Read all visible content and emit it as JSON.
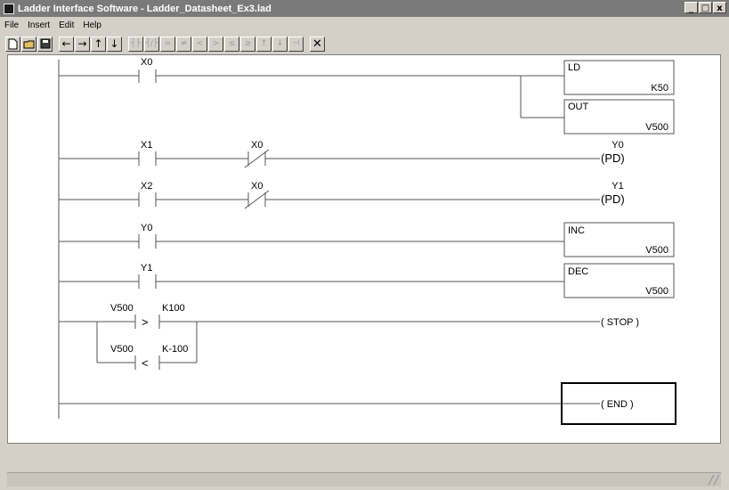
{
  "window": {
    "title": "Ladder Interface Software - Ladder_Datasheet_Ex3.lad",
    "controls": [
      "_",
      "□",
      "x"
    ]
  },
  "menu": {
    "items": [
      "File",
      "Insert",
      "Edit",
      "Help"
    ]
  },
  "toolbar": {
    "new_icon": "new-document-icon",
    "open_icon": "open-folder-icon",
    "save_icon": "save-disk-icon",
    "arrows": [
      "←",
      "→",
      "↑",
      "↓"
    ],
    "delete_label": "✕"
  },
  "ladder": {
    "rung1": {
      "contact": "X0",
      "coil1": "LD",
      "coil1_value": "K50",
      "coil2": "OUT",
      "coil2_value": "V500"
    },
    "rung2": {
      "contact1": "X1",
      "contact2": "X0",
      "output": "Y0",
      "output_type": "(PD)"
    },
    "rung3": {
      "contact1": "X2",
      "contact2": "X0",
      "output": "Y1",
      "output_type": "(PD)"
    },
    "rung4": {
      "contact": "Y0",
      "box": "INC",
      "box_value": "V500"
    },
    "rung5": {
      "contact": "Y1",
      "box": "DEC",
      "box_value": "V500"
    },
    "rung6": {
      "cmp1_left": "V500",
      "cmp1_op": ">",
      "cmp1_right": "K100",
      "cmp2_left": "V500",
      "cmp2_op": "<",
      "cmp2_right": "K-100",
      "output": "( STOP )"
    },
    "rung7": {
      "output": "( END )"
    }
  }
}
